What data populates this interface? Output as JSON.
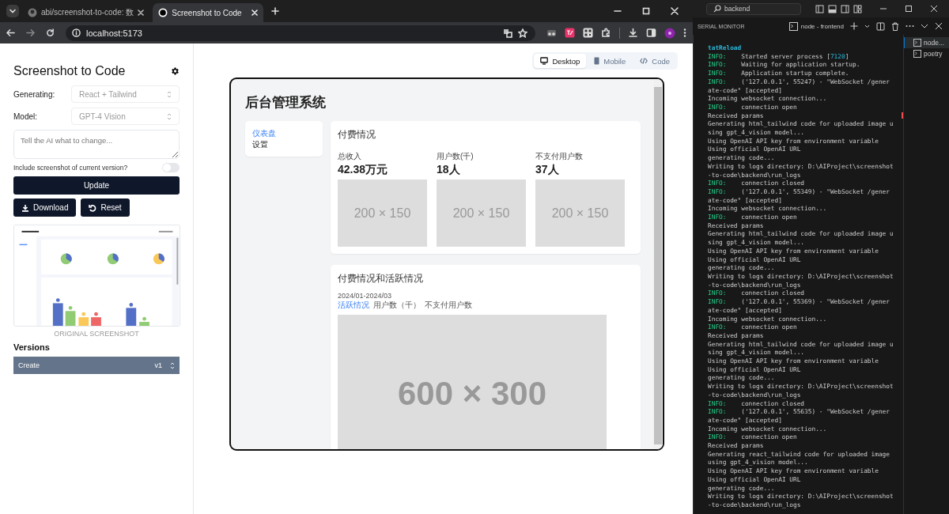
{
  "browser": {
    "tabs": [
      {
        "title": "abi/screenshot-to-code: 数",
        "selected": false
      },
      {
        "title": "Screenshot to Code",
        "selected": true
      }
    ],
    "address": "localhost:5173"
  },
  "sidebar": {
    "title": "Screenshot to Code",
    "fields": [
      {
        "label": "Generating:",
        "value": "React + Tailwind",
        "disabled": true
      },
      {
        "label": "Model:",
        "value": "GPT-4 Vision",
        "disabled": true
      }
    ],
    "instructions": {
      "placeholder": "Tell the AI what to change..."
    },
    "include_screenshot": {
      "label": "Include screenshot of current version?",
      "on": false
    },
    "update_button": "Update",
    "actions": [
      {
        "kind": "download",
        "label": "Download"
      },
      {
        "kind": "reset",
        "label": "Reset"
      }
    ],
    "screenshot_caption": "ORIGINAL SCREENSHOT",
    "versions_title": "Versions",
    "versions": [
      {
        "label": "Create",
        "version": "v1",
        "selected": true
      }
    ]
  },
  "view_modes": [
    {
      "kind": "desktop",
      "label": "Desktop",
      "selected": true
    },
    {
      "kind": "mobile",
      "label": "Mobile",
      "selected": false
    },
    {
      "kind": "code",
      "label": "Code",
      "selected": false
    }
  ],
  "preview": {
    "title": "后台管理系统",
    "nav": [
      {
        "label": "仪表盘",
        "selected": true
      },
      {
        "label": "设置",
        "selected": false
      }
    ],
    "payment_card": {
      "title": "付费情况",
      "stats": [
        {
          "label": "总收入",
          "value": "42.38万元",
          "image": "200 × 150"
        },
        {
          "label": "用户数(千)",
          "value": "18人",
          "image": "200 × 150"
        },
        {
          "label": "不支付用户数",
          "value": "37人",
          "image": "200 × 150"
        }
      ]
    },
    "activity_card": {
      "title": "付费情况和活跃情况",
      "date_range": "2024/01-2024/03",
      "legend": [
        {
          "label": "活跃情况",
          "selected": true
        },
        {
          "label": "用户数（千）",
          "selected": false
        },
        {
          "label": "不支付用户数",
          "selected": false
        }
      ],
      "image": "600 × 300"
    }
  },
  "terminal": {
    "search": "backend",
    "panel_title": "SERIAL MONITOR",
    "active_terminal": "node - frontend",
    "terminals": [
      {
        "label": "node...",
        "selected": true
      },
      {
        "label": "poetry",
        "selected": false
      }
    ],
    "lines": [
      {
        "kind": "highlight",
        "text": "tatReload"
      },
      {
        "kind": "info",
        "prefix": "INFO:",
        "text": "Started server process [",
        "number": "7120",
        "tail": "]"
      },
      {
        "kind": "info",
        "prefix": "INFO:",
        "text": "Waiting for application startup."
      },
      {
        "kind": "info",
        "prefix": "INFO:",
        "text": "Application startup complete."
      },
      {
        "kind": "info",
        "prefix": "INFO:",
        "text": "('127.0.0.1', 55247) - \"WebSocket /gener"
      },
      {
        "kind": "plain",
        "text": "ate-code\" [accepted]"
      },
      {
        "kind": "plain",
        "text": "Incoming websocket connection..."
      },
      {
        "kind": "info",
        "prefix": "INFO:",
        "text": "connection open"
      },
      {
        "kind": "plain",
        "text": "Received params"
      },
      {
        "kind": "plain",
        "text": "Generating html_tailwind code for uploaded image u"
      },
      {
        "kind": "plain",
        "text": "sing gpt_4_vision model..."
      },
      {
        "kind": "plain",
        "text": "Using OpenAI API key from environment variable"
      },
      {
        "kind": "plain",
        "text": "Using official OpenAI URL"
      },
      {
        "kind": "plain",
        "text": "generating code..."
      },
      {
        "kind": "plain",
        "text": "Writing to logs directory: D:\\AIProject\\screenshot"
      },
      {
        "kind": "plain",
        "text": "-to-code\\backend\\run_logs"
      },
      {
        "kind": "info",
        "prefix": "INFO:",
        "text": "connection closed"
      },
      {
        "kind": "info",
        "prefix": "INFO:",
        "text": "('127.0.0.1', 55349) - \"WebSocket /gener"
      },
      {
        "kind": "plain",
        "text": "ate-code\" [accepted]"
      },
      {
        "kind": "plain",
        "text": "Incoming websocket connection..."
      },
      {
        "kind": "info",
        "prefix": "INFO:",
        "text": "connection open"
      },
      {
        "kind": "plain",
        "text": "Received params"
      },
      {
        "kind": "plain",
        "text": "Generating html_tailwind code for uploaded image u"
      },
      {
        "kind": "plain",
        "text": "sing gpt_4_vision model..."
      },
      {
        "kind": "plain",
        "text": "Using OpenAI API key from environment variable"
      },
      {
        "kind": "plain",
        "text": "Using official OpenAI URL"
      },
      {
        "kind": "plain",
        "text": "generating code..."
      },
      {
        "kind": "plain",
        "text": "Writing to logs directory: D:\\AIProject\\screenshot"
      },
      {
        "kind": "plain",
        "text": "-to-code\\backend\\run_logs"
      },
      {
        "kind": "info",
        "prefix": "INFO:",
        "text": "connection closed"
      },
      {
        "kind": "info",
        "prefix": "INFO:",
        "text": "('127.0.0.1', 55369) - \"WebSocket /gener"
      },
      {
        "kind": "plain",
        "text": "ate-code\" [accepted]"
      },
      {
        "kind": "plain",
        "text": "Incoming websocket connection..."
      },
      {
        "kind": "info",
        "prefix": "INFO:",
        "text": "connection open"
      },
      {
        "kind": "plain",
        "text": "Received params"
      },
      {
        "kind": "plain",
        "text": "Generating html_tailwind code for uploaded image u"
      },
      {
        "kind": "plain",
        "text": "sing gpt_4_vision model..."
      },
      {
        "kind": "plain",
        "text": "Using OpenAI API key from environment variable"
      },
      {
        "kind": "plain",
        "text": "Using official OpenAI URL"
      },
      {
        "kind": "plain",
        "text": "generating code..."
      },
      {
        "kind": "plain",
        "text": "Writing to logs directory: D:\\AIProject\\screenshot"
      },
      {
        "kind": "plain",
        "text": "-to-code\\backend\\run_logs"
      },
      {
        "kind": "info",
        "prefix": "INFO:",
        "text": "connection closed"
      },
      {
        "kind": "info",
        "prefix": "INFO:",
        "text": "('127.0.0.1', 55635) - \"WebSocket /gener"
      },
      {
        "kind": "plain",
        "text": "ate-code\" [accepted]"
      },
      {
        "kind": "plain",
        "text": "Incoming websocket connection..."
      },
      {
        "kind": "info",
        "prefix": "INFO:",
        "text": "connection open"
      },
      {
        "kind": "plain",
        "text": "Received params"
      },
      {
        "kind": "plain",
        "text": "Generating react_tailwind code for uploaded image"
      },
      {
        "kind": "plain",
        "text": "using gpt_4_vision model..."
      },
      {
        "kind": "plain",
        "text": "Using OpenAI API key from environment variable"
      },
      {
        "kind": "plain",
        "text": "Using official OpenAI URL"
      },
      {
        "kind": "plain",
        "text": "generating code..."
      },
      {
        "kind": "plain",
        "text": "Writing to logs directory: D:\\AIProject\\screenshot"
      },
      {
        "kind": "plain",
        "text": "-to-code\\backend\\run_logs"
      }
    ]
  }
}
